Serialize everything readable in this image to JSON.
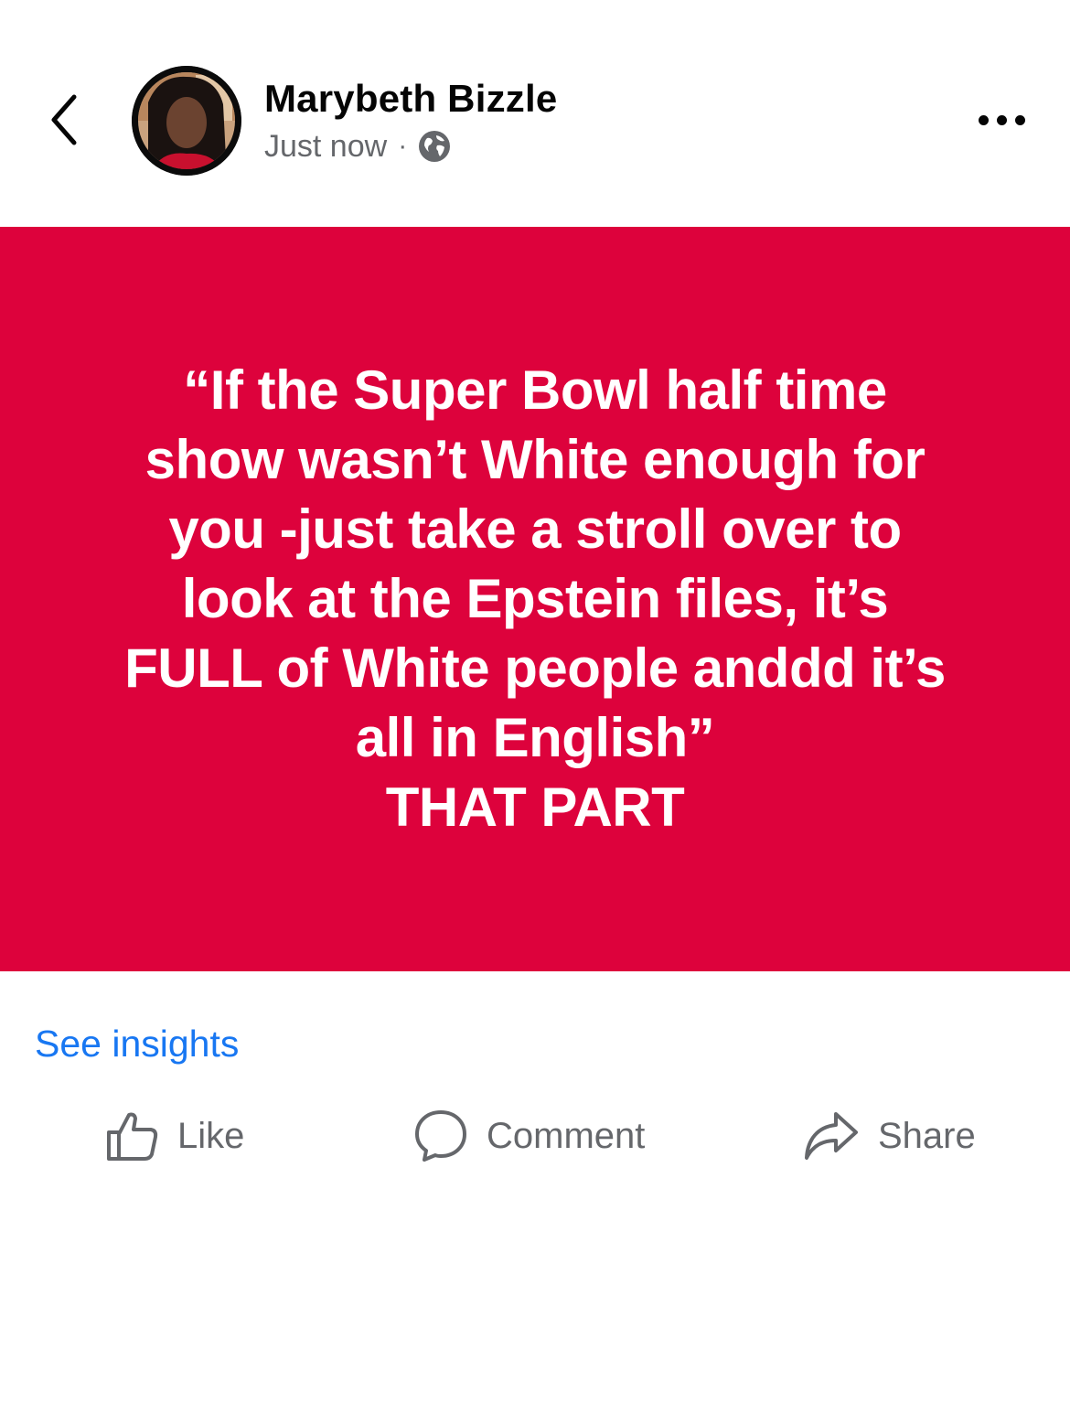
{
  "header": {
    "author_name": "Marybeth Bizzle",
    "timestamp": "Just now",
    "separator": "·",
    "privacy_icon": "globe-icon",
    "back_icon": "chevron-left-icon",
    "more_icon": "more-horizontal-icon"
  },
  "post": {
    "background_color": "#dd023c",
    "text_color": "#ffffff",
    "text": "“If the Super Bowl half time\nshow wasn’t White enough for\nyou -just take a stroll over to\nlook at the Epstein files, it’s\nFULL of White people anddd it’s\nall in English”\nTHAT PART"
  },
  "insights": {
    "label": "See insights",
    "color": "#1877f2"
  },
  "actions": [
    {
      "label": "Like",
      "icon": "thumbs-up-icon"
    },
    {
      "label": "Comment",
      "icon": "comment-icon"
    },
    {
      "label": "Share",
      "icon": "share-icon"
    }
  ]
}
